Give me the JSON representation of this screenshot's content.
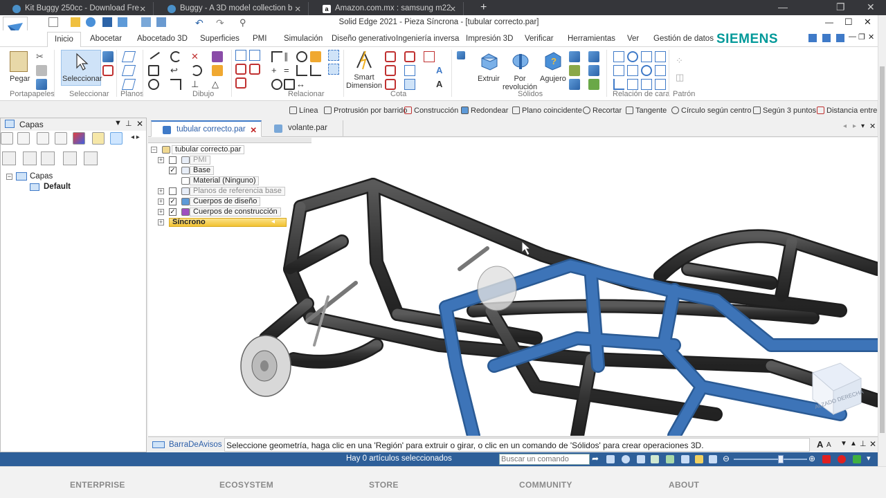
{
  "browser": {
    "tabs": [
      {
        "title": "Kit Buggy 250cc - Download Fre"
      },
      {
        "title": "Buggy - A 3D model collection b"
      },
      {
        "title": "Amazon.com.mx : samsung m22"
      }
    ],
    "new_tab": "+"
  },
  "window": {
    "title": "Solid Edge 2021 - Pieza Síncrona - [tubular correcto.par]",
    "controls": {
      "minimize": "—",
      "maximize": "☐",
      "close": "✕"
    }
  },
  "ribbon": {
    "tabs": [
      "Inicio",
      "Abocetar",
      "Abocetado 3D",
      "Superficies",
      "PMI",
      "Simulación",
      "Diseño generativo",
      "Ingeniería inversa",
      "Impresión 3D",
      "Verificar",
      "Herramientas",
      "Ver",
      "Gestión de datos"
    ],
    "active_tab": "Inicio",
    "brand": "SIEMENS",
    "groups": {
      "portapapeles": {
        "label": "Portapapeles",
        "paste": "Pegar"
      },
      "seleccionar": {
        "label": "Seleccionar",
        "select": "Seleccionar"
      },
      "planos": {
        "label": "Planos"
      },
      "dibujo": {
        "label": "Dibujo"
      },
      "relacionar": {
        "label": "Relacionar"
      },
      "cota": {
        "label": "Cota",
        "smart": "Smart Dimension"
      },
      "solidos": {
        "label": "Sólidos",
        "extrude": "Extruir",
        "revolve": "Por revolución",
        "hole": "Agujero"
      },
      "relacion_cara": {
        "label": "Relación de cara"
      },
      "patron": {
        "label": "Patrón"
      }
    }
  },
  "command_bar": {
    "items": [
      "Línea",
      "Protrusión por barrido",
      "Construcción",
      "Redondear",
      "Plano coincidente",
      "Recortar",
      "Tangente",
      "Círculo según centro",
      "Según 3 puntos",
      "Distancia entre"
    ]
  },
  "layers_pane": {
    "title": "Capas",
    "tree": {
      "root": "Capas",
      "child": "Default"
    }
  },
  "documents": {
    "tabs": [
      {
        "name": "tubular correcto.par",
        "active": true
      },
      {
        "name": "volante.par",
        "active": false
      }
    ]
  },
  "pathfinder": {
    "root": "tubular correcto.par",
    "items": [
      {
        "label": "PMI",
        "checked": false,
        "expandable": true
      },
      {
        "label": "Base",
        "checked": true,
        "expandable": false
      },
      {
        "label": "Material (Ninguno)",
        "checked": null,
        "expandable": false
      },
      {
        "label": "Planos de referencia base",
        "checked": false,
        "expandable": true
      },
      {
        "label": "Cuerpos de diseño",
        "checked": true,
        "expandable": true
      },
      {
        "label": "Cuerpos de construcción",
        "checked": true,
        "expandable": true
      },
      {
        "label": "Síncrono",
        "checked": null,
        "expandable": true
      }
    ]
  },
  "view_cube_label": "ALZADO DERECHA",
  "prompt": {
    "label": "BarraDeAvisos",
    "text": "Seleccione geometría, haga clic en una 'Región' para extruir o girar, o clic en un comando de 'Sólidos' para crear operaciones 3D."
  },
  "status": {
    "text": "Hay 0 artículos seleccionados",
    "search_placeholder": "Buscar un comando"
  },
  "footer": {
    "links": [
      "ENTERPRISE",
      "ECOSYSTEM",
      "STORE",
      "COMMUNITY",
      "ABOUT"
    ]
  },
  "colors": {
    "status_bar": "#2e5f99",
    "brand": "#009999",
    "tube_dark": "#3a3a3a",
    "tube_blue": "#3d74b8"
  }
}
